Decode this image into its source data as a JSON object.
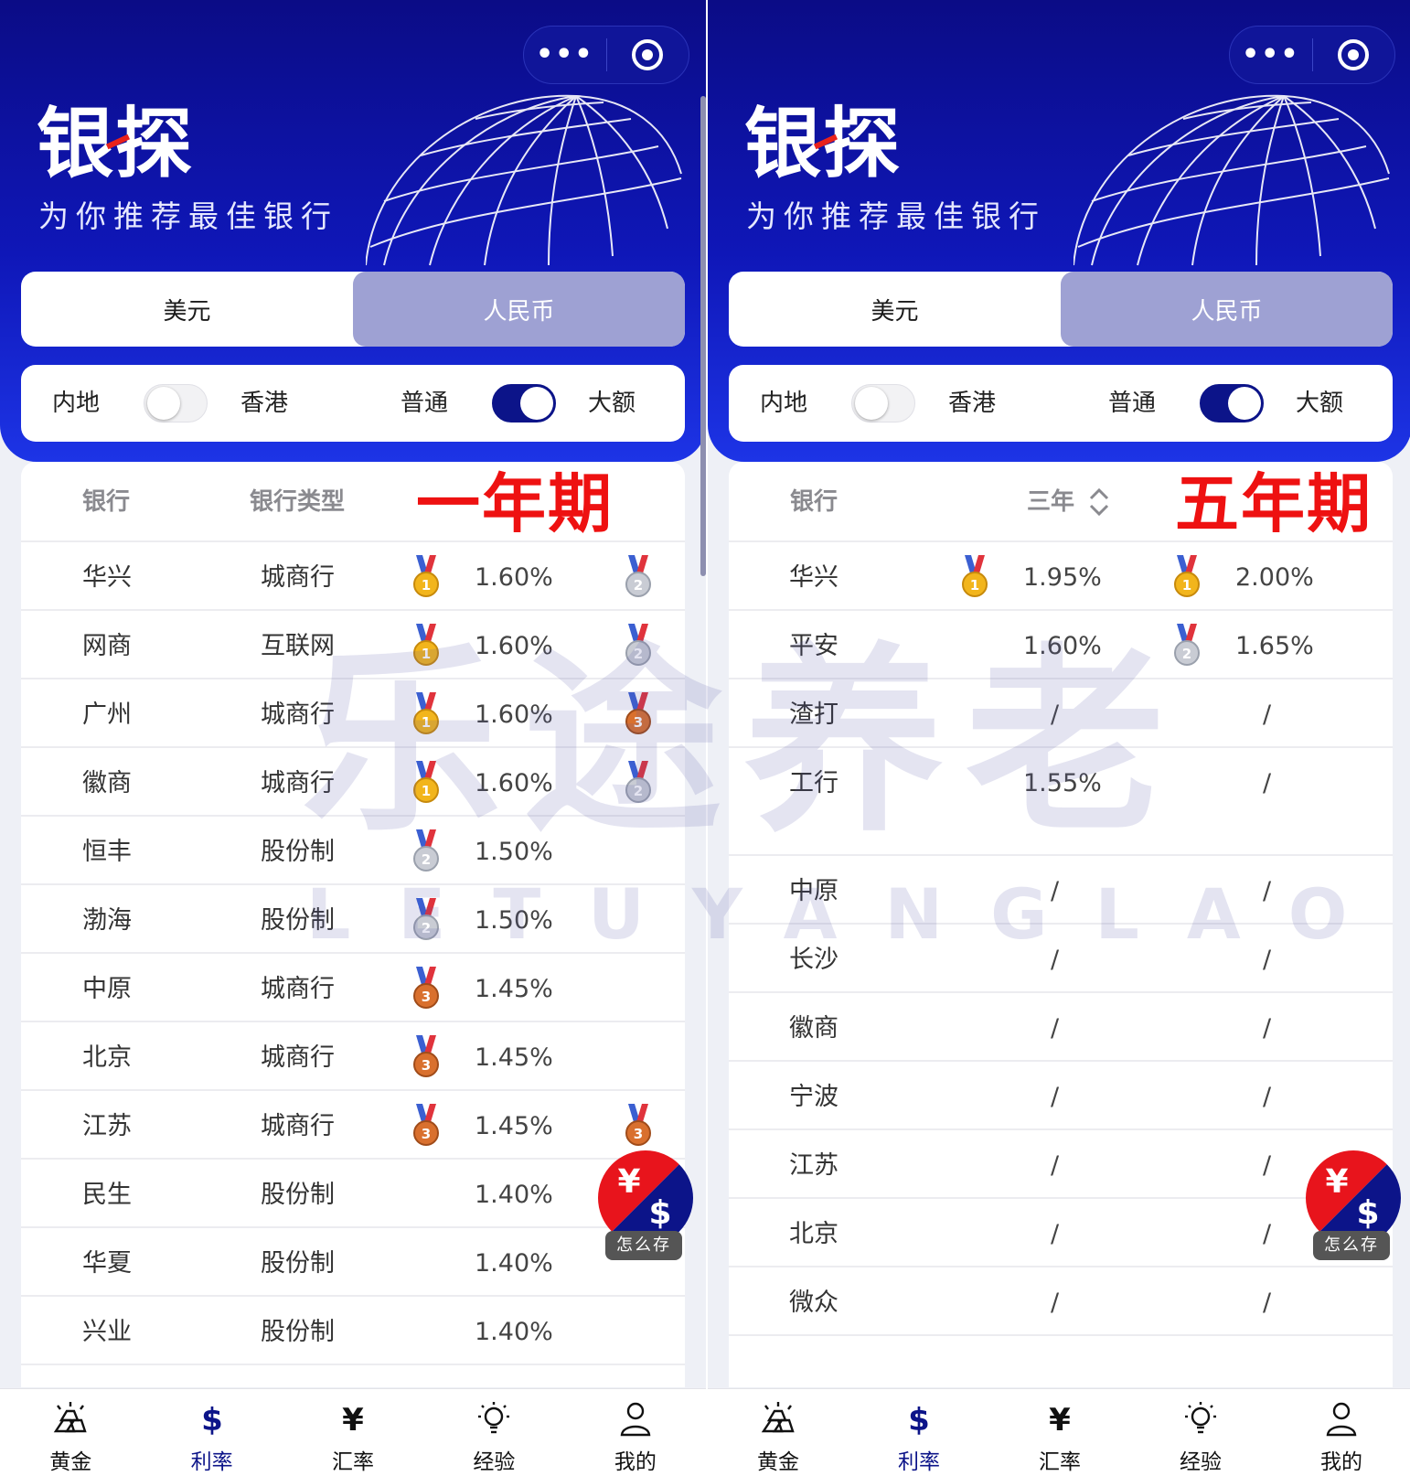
{
  "panels": [
    {
      "brand": "银探",
      "slogan": "为你推荐最佳银行",
      "currency_tabs": [
        "美元",
        "人民币"
      ],
      "active_tab": "人民币",
      "filters": {
        "region_left": "内地",
        "region_right": "香港",
        "region_on": false,
        "amount_left": "普通",
        "amount_right": "大额",
        "amount_on": true
      },
      "columns": {
        "bank": "银行",
        "type": "银行类型"
      },
      "period_label": "一年期",
      "rows": [
        {
          "bank": "华兴",
          "type": "城商行",
          "medal": "gold",
          "rate": "1.60%",
          "medal2": "silver"
        },
        {
          "bank": "网商",
          "type": "互联网",
          "medal": "gold",
          "rate": "1.60%",
          "medal2": "silver"
        },
        {
          "bank": "广州",
          "type": "城商行",
          "medal": "gold",
          "rate": "1.60%",
          "medal2": "bronze"
        },
        {
          "bank": "徽商",
          "type": "城商行",
          "medal": "gold",
          "rate": "1.60%",
          "medal2": "silver"
        },
        {
          "bank": "恒丰",
          "type": "股份制",
          "medal": "silver",
          "rate": "1.50%",
          "medal2": ""
        },
        {
          "bank": "渤海",
          "type": "股份制",
          "medal": "silver",
          "rate": "1.50%",
          "medal2": ""
        },
        {
          "bank": "中原",
          "type": "城商行",
          "medal": "bronze",
          "rate": "1.45%",
          "medal2": ""
        },
        {
          "bank": "北京",
          "type": "城商行",
          "medal": "bronze",
          "rate": "1.45%",
          "medal2": ""
        },
        {
          "bank": "江苏",
          "type": "城商行",
          "medal": "bronze",
          "rate": "1.45%",
          "medal2": "bronze"
        },
        {
          "bank": "民生",
          "type": "股份制",
          "medal": "",
          "rate": "1.40%",
          "medal2": ""
        },
        {
          "bank": "华夏",
          "type": "股份制",
          "medal": "",
          "rate": "1.40%",
          "medal2": ""
        },
        {
          "bank": "兴业",
          "type": "股份制",
          "medal": "",
          "rate": "1.40%",
          "medal2": ""
        }
      ],
      "fab_label": "怎么存",
      "fab_symbols": {
        "yuan": "¥",
        "dollar": "$"
      }
    },
    {
      "brand": "银探",
      "slogan": "为你推荐最佳银行",
      "currency_tabs": [
        "美元",
        "人民币"
      ],
      "active_tab": "人民币",
      "filters": {
        "region_left": "内地",
        "region_right": "香港",
        "region_on": false,
        "amount_left": "普通",
        "amount_right": "大额",
        "amount_on": true
      },
      "columns": {
        "bank": "银行",
        "term": "三年"
      },
      "period_label": "五年期",
      "rows": [
        {
          "bank": "华兴",
          "medal": "gold",
          "rate3": "1.95%",
          "medal2": "gold",
          "rate5": "2.00%"
        },
        {
          "bank": "平安",
          "medal": "",
          "rate3": "1.60%",
          "medal2": "silver",
          "rate5": "1.65%"
        },
        {
          "bank": "渣打",
          "medal": "",
          "rate3": "/",
          "medal2": "",
          "rate5": "/"
        },
        {
          "bank": "工行",
          "medal": "",
          "rate3": "1.55%",
          "medal2": "",
          "rate5": "/"
        },
        {
          "bank": "中原",
          "medal": "",
          "rate3": "/",
          "medal2": "",
          "rate5": "/"
        },
        {
          "bank": "长沙",
          "medal": "",
          "rate3": "/",
          "medal2": "",
          "rate5": "/"
        },
        {
          "bank": "徽商",
          "medal": "",
          "rate3": "/",
          "medal2": "",
          "rate5": "/"
        },
        {
          "bank": "宁波",
          "medal": "",
          "rate3": "/",
          "medal2": "",
          "rate5": "/"
        },
        {
          "bank": "江苏",
          "medal": "",
          "rate3": "/",
          "medal2": "",
          "rate5": "/"
        },
        {
          "bank": "北京",
          "medal": "",
          "rate3": "/",
          "medal2": "",
          "rate5": "/"
        },
        {
          "bank": "微众",
          "medal": "",
          "rate3": "/",
          "medal2": "",
          "rate5": "/"
        }
      ],
      "fab_label": "怎么存",
      "fab_symbols": {
        "yuan": "¥",
        "dollar": "$"
      }
    }
  ],
  "nav": [
    {
      "label": "黄金",
      "icon": "gold-bars-icon"
    },
    {
      "label": "利率",
      "icon": "dollar-icon",
      "symbol": "$"
    },
    {
      "label": "汇率",
      "icon": "yen-icon",
      "symbol": "¥"
    },
    {
      "label": "经验",
      "icon": "lightbulb-icon"
    },
    {
      "label": "我的",
      "icon": "user-icon"
    }
  ],
  "active_nav": "利率",
  "watermark": {
    "main": "乐途养老",
    "sub": "LETUYANGLAO"
  },
  "colors": {
    "header_dark": "#0b0c86",
    "header_light": "#1d34e6",
    "active_tab_bg": "#9ea1d3",
    "toggle_on": "#0c1489",
    "period_red": "#ee1111",
    "fab_red": "#e8141c",
    "fab_navy": "#0c1489"
  }
}
